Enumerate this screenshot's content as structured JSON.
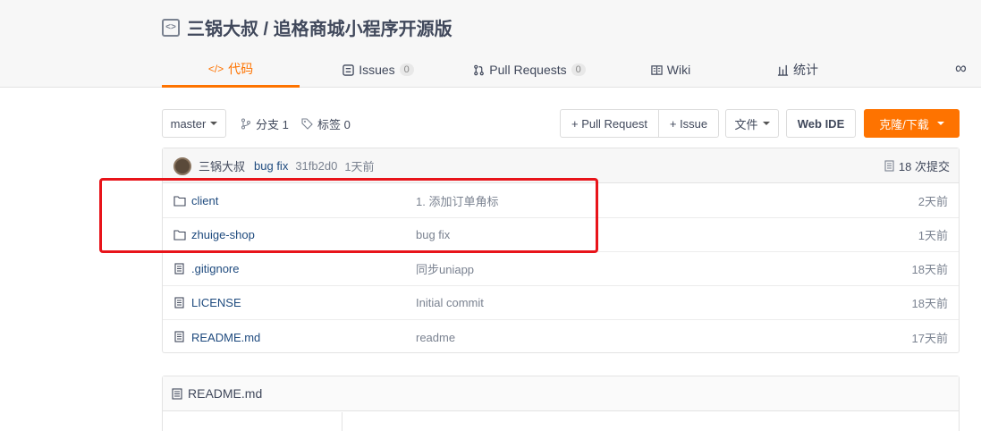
{
  "repo": {
    "title": "三锅大叔 / 追格商城小程序开源版"
  },
  "tabs": [
    {
      "label": "代码",
      "icon": "code-icon",
      "active": true
    },
    {
      "label": "Issues",
      "count": "0",
      "icon": "issues-icon"
    },
    {
      "label": "Pull Requests",
      "count": "0",
      "icon": "pull-request-icon"
    },
    {
      "label": "Wiki",
      "icon": "wiki-icon"
    },
    {
      "label": "统计",
      "icon": "stats-icon"
    }
  ],
  "toolbar": {
    "branch": "master",
    "branches_label": "分支 1",
    "tags_label": "标签 0",
    "pull_request_label": "+ Pull Request",
    "issue_label": "+ Issue",
    "files_label": "文件",
    "web_ide_label": "Web IDE",
    "clone_label": "克隆/下载"
  },
  "last_commit": {
    "author": "三锅大叔",
    "message": "bug fix",
    "hash": "31fb2d0",
    "time": "1天前",
    "count_label": "18 次提交"
  },
  "files": [
    {
      "name": "client",
      "type": "folder",
      "message": "1. 添加订单角标",
      "date": "2天前"
    },
    {
      "name": "zhuige-shop",
      "type": "folder",
      "message": "bug fix",
      "date": "1天前"
    },
    {
      "name": ".gitignore",
      "type": "file",
      "message": "同步uniapp",
      "date": "18天前"
    },
    {
      "name": "LICENSE",
      "type": "file",
      "message": "Initial commit",
      "date": "18天前"
    },
    {
      "name": "README.md",
      "type": "file",
      "message": "readme",
      "date": "17天前"
    }
  ],
  "readme": {
    "title": "README.md"
  },
  "colors": {
    "accent": "#fe7300",
    "link": "#1e4a7e",
    "highlight": "#e8141a"
  }
}
